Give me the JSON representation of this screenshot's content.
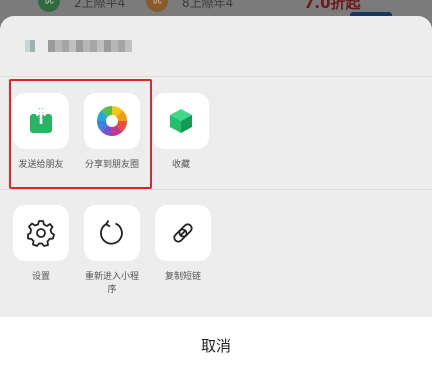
{
  "background_page": {
    "avatar1_text": "优",
    "text1": "2上際平4",
    "avatar2_text": "优",
    "text2": "8上際年4",
    "price": "7.0折起"
  },
  "share_sheet": {
    "row1": [
      {
        "label": "发送给朋友",
        "icon": "share-upload-icon",
        "color": "#27b564"
      },
      {
        "label": "分享到朋友圈",
        "icon": "moments-aperture-icon",
        "color": "#f5a623"
      },
      {
        "label": "收藏",
        "icon": "favorite-cube-icon",
        "color": "#21c06c"
      }
    ],
    "row2": [
      {
        "label": "设置",
        "icon": "gear-icon"
      },
      {
        "label": "重新进入小程序",
        "icon": "refresh-icon"
      },
      {
        "label": "复制短链",
        "icon": "link-icon"
      }
    ],
    "cancel_label": "取消",
    "highlight_color": "#e0252b"
  }
}
